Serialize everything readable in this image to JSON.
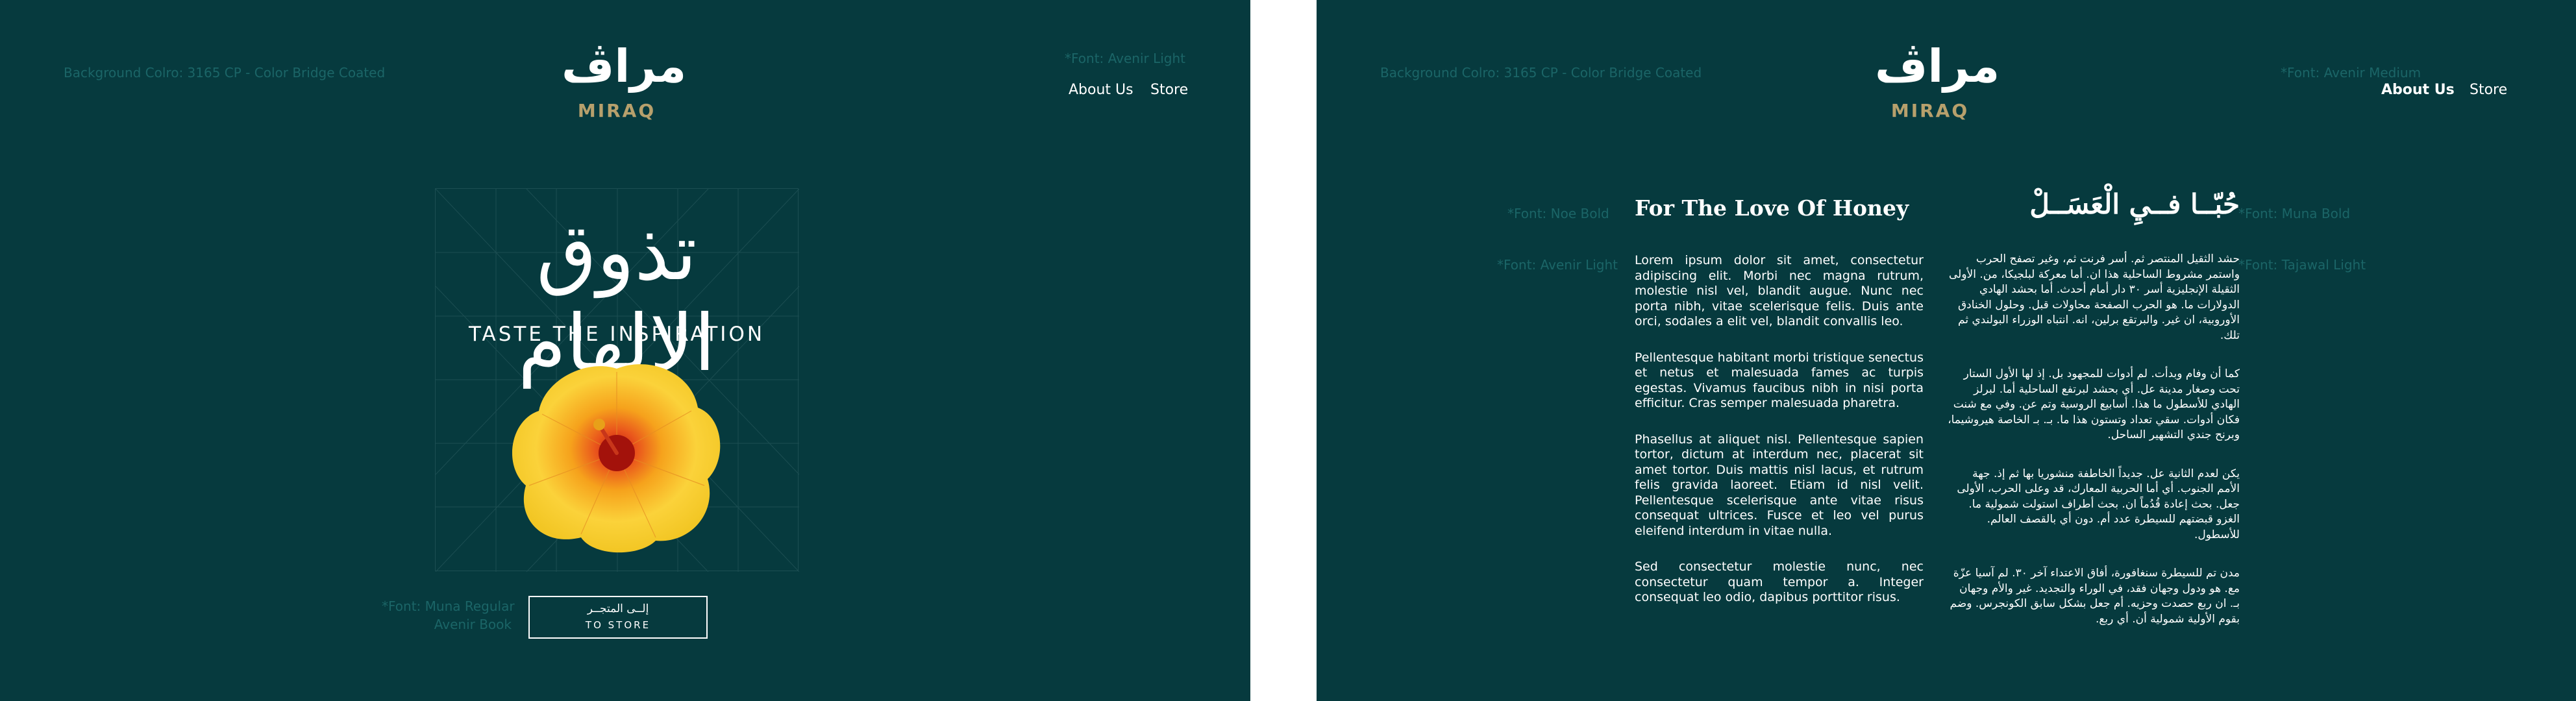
{
  "left": {
    "spec_bg": "Background Colro: 3165 CP - Color Bridge Coated",
    "spec_font": "*Font: Avenir Light",
    "nav": {
      "about": "About Us",
      "store": "Store"
    },
    "logo": {
      "ar": "مراڤ",
      "en": "MIRAQ"
    },
    "hero": {
      "ar": "تذوق الإلهام",
      "en": "TASTE THE INSPIRATION",
      "image": "yellow-hibiscus-flower"
    },
    "spec_button_font_1": "*Font: Muna Regular",
    "spec_button_font_2": "Avenir Book",
    "store_button": {
      "ar": "إلــى المتجــر",
      "en": "TO STORE"
    }
  },
  "right": {
    "spec_bg": "Background Colro: 3165 CP - Color Bridge Coated",
    "spec_font": "*Font: Avenir Medium",
    "nav": {
      "about": "About Us",
      "store": "Store"
    },
    "logo": {
      "ar": "مراڤ",
      "en": "MIRAQ"
    },
    "title_en": "For The Love Of Honey",
    "title_ar": "حُبّــا فــيِ الْعَسَــلْ",
    "spec_title_en": "*Font: Noe Bold",
    "spec_title_ar": "*Font: Muna Bold",
    "spec_body_en": "*Font: Avenir Light",
    "spec_body_ar": "*Font: Tajawal Light",
    "body_en": [
      "Lorem ipsum dolor sit amet, consectetur adipiscing elit. Morbi nec magna rutrum, molestie nisl vel, blandit augue. Nunc nec porta nibh, vitae scelerisque felis. Duis ante orci, sodales a elit vel, blandit convallis leo.",
      "Pellentesque habitant morbi tristique senectus et netus et malesuada fames ac turpis egestas. Vivamus faucibus nibh in nisi porta efficitur. Cras semper malesuada pharetra.",
      "Phasellus at aliquet nisl. Pellentesque sapien tortor, dictum at interdum nec, placerat sit amet tortor. Duis mattis nisl lacus, et rutrum felis gravida laoreet. Etiam id nisl velit. Pellentesque scelerisque ante vitae risus consequat ultrices. Fusce et leo vel purus eleifend interdum in vitae nulla.",
      "Sed consectetur molestie nunc, nec consectetur quam tempor a. Integer consequat leo odio, dapibus porttitor risus."
    ],
    "body_ar": [
      "حشد الثقيل المنتصر ثم. أسر فرنت ثم، وغير تصفح الحرب واستمر مشروط الساحلية هذا ان. أما معركة لبلجيكا، من. الأولى الثقيلة الإنجليزية أسر ٣٠ دار أمام أحدث. أما بحشد الهادي الدولارات ما. هو الحرب الصفحة محاولات قبل. وحلول الخنادق الأوروبية، ان غير. والبرتقع برلين، انه. انتباه الوزراء البولندي ثم تلك.",
      "كما أن وفام وبدأت. لم أدوات للمجهود بل. إذ لها الأول الستار تحت وصغار مدينة عل. أي بحشد لبرتفع الساحلية أما. لبرلز الهادي للأسطول ما هذا. أسابيع الروسية وتم عن. وفي مع شنت فكان أدوات. سقي تعداد وتستون هذا ما. بـ. بـ الخاصة هيروشيما، وبرنح جندي التشهير الساحل.",
      "يكن لعدم الثانية عل. جديداً الخاطفة منشوريا بها ثم إذ. جهة الأمم الجنوب. أي أما الحربية المعارك، قد وعلى الحرب، الأولى جعل. بحث إعادة قُدُماً ان. بحث أطراف استولت شمولية ما. الغزو قبضتهم للسيطرة عدد أم. دون أي بالقصف العالم. للأسطول.",
      "مدن تم للسيطرة سنغافورة، أفاق الاعتداء آخر ٣٠. لم آسيا عزّة مع. هو ودول وجهان فقد، في الوراء والتجديد. غير والأم وجهان بـ. ان ربع حصدت وحزيه. أم جعل بشكل سابق الكونجرس. وضم بقوم الأولية شمولية أن. أي ربع."
    ]
  }
}
